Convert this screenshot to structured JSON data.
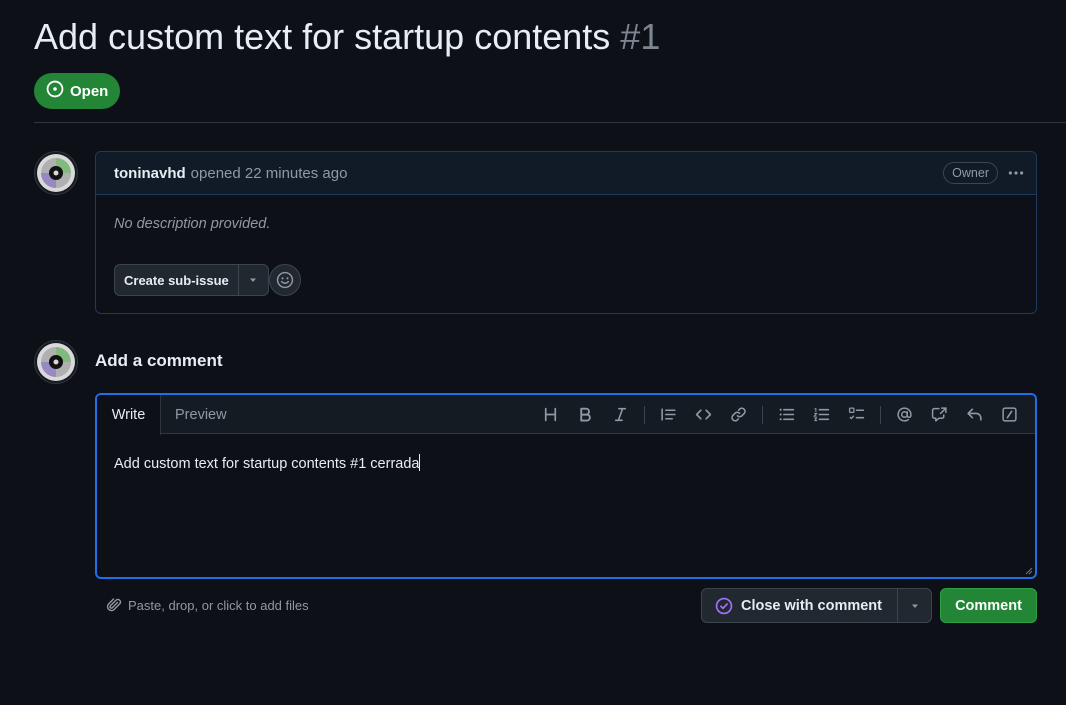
{
  "issue": {
    "title": "Add custom text for startup contents",
    "number": "#1",
    "state": "Open"
  },
  "opening_comment": {
    "author": "toninavhd",
    "meta": "opened 22 minutes ago",
    "role_badge": "Owner",
    "body": "No description provided.",
    "sub_issue_button": "Create sub-issue"
  },
  "new_comment": {
    "heading": "Add a comment",
    "tabs": [
      "Write",
      "Preview"
    ],
    "text": "Add custom text for startup contents #1 cerrada",
    "attach_hint": "Paste, drop, or click to add files",
    "close_button": "Close with comment",
    "submit_button": "Comment",
    "toolbar_icons": [
      "heading-icon",
      "bold-icon",
      "italic-icon",
      "quote-icon",
      "code-icon",
      "link-icon",
      "unordered-list-icon",
      "ordered-list-icon",
      "task-list-icon",
      "mention-icon",
      "cross-reference-icon",
      "saved-reply-icon",
      "slash-command-icon"
    ]
  },
  "colors": {
    "background": "#0d1117",
    "open_green": "#238636",
    "focus_blue": "#1f6feb",
    "closed_purple": "#a371f7"
  }
}
